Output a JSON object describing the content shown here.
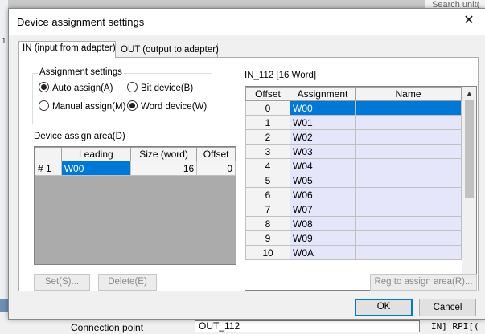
{
  "background": {
    "search_placeholder": "Search unit(",
    "left_marker": "1",
    "connection_label": "Connection point",
    "connection_value": "OUT_112",
    "code_text": "IN] RPI[("
  },
  "dialog": {
    "title": "Device assignment settings",
    "close_glyph": "✕",
    "tabs": [
      {
        "label": "IN (input from adapter)",
        "active": true
      },
      {
        "label": "OUT (output to adapter)",
        "active": false
      }
    ],
    "assignment_settings": {
      "legend": "Assignment settings",
      "auto_assign": "Auto assign(A)",
      "manual_assign": "Manual assign(M)",
      "bit_device": "Bit device(B)",
      "word_device": "Word device(W)"
    },
    "device_assign_area": {
      "label": "Device assign area(D)",
      "columns": [
        "Leading",
        "Size (word)",
        "Offset"
      ],
      "rows": [
        {
          "id": "# 1",
          "leading": "W00",
          "size": "16",
          "offset": "0"
        }
      ]
    },
    "in_grid": {
      "label": "IN_112 [16 Word]",
      "columns": [
        "Offset",
        "Assignment",
        "Name"
      ],
      "rows": [
        {
          "offset": "0",
          "assignment": "W00",
          "name": ""
        },
        {
          "offset": "1",
          "assignment": "W01",
          "name": ""
        },
        {
          "offset": "2",
          "assignment": "W02",
          "name": ""
        },
        {
          "offset": "3",
          "assignment": "W03",
          "name": ""
        },
        {
          "offset": "4",
          "assignment": "W04",
          "name": ""
        },
        {
          "offset": "5",
          "assignment": "W05",
          "name": ""
        },
        {
          "offset": "6",
          "assignment": "W06",
          "name": ""
        },
        {
          "offset": "7",
          "assignment": "W07",
          "name": ""
        },
        {
          "offset": "8",
          "assignment": "W08",
          "name": ""
        },
        {
          "offset": "9",
          "assignment": "W09",
          "name": ""
        },
        {
          "offset": "10",
          "assignment": "W0A",
          "name": ""
        }
      ]
    },
    "buttons": {
      "set": "Set(S)...",
      "delete": "Delete(E)",
      "reg": "Reg to assign area(R)...",
      "ok": "OK",
      "cancel": "Cancel"
    }
  }
}
